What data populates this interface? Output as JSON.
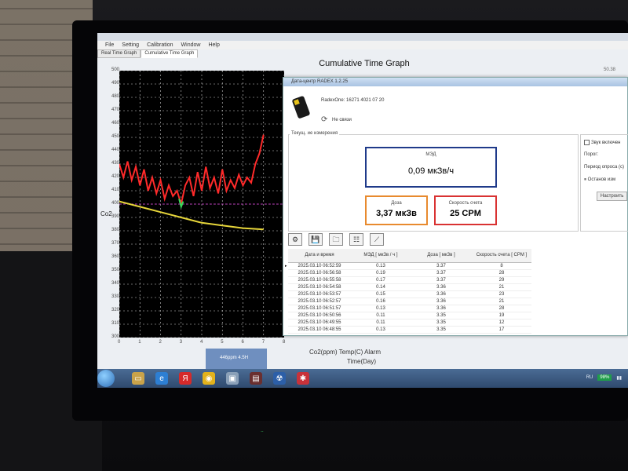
{
  "app": {
    "window_title": "Cumulative Time Graph",
    "menu": [
      "File",
      "Setting",
      "Calibration",
      "Window",
      "Help"
    ],
    "tabs": [
      "Real Time Graph",
      "Cumulative Time Graph"
    ],
    "graph_title": "Cumulative Time Graph",
    "corner_value": "50.38",
    "y_ticks": [
      "500",
      "490",
      "480",
      "470",
      "460",
      "450",
      "440",
      "430",
      "420",
      "410",
      "400",
      "390",
      "380",
      "370",
      "360",
      "350",
      "340",
      "330",
      "320",
      "310",
      "300"
    ],
    "x_ticks": [
      "0",
      "1",
      "2",
      "3",
      "4",
      "5",
      "6",
      "7",
      "8"
    ],
    "y_label": "Co2",
    "legend": "Co2(ppm)  Temp(C)  Alarm",
    "x_label": "Time(Day)",
    "status_box": "446ppm 4.5H"
  },
  "chart_data": {
    "type": "line",
    "xlim": [
      0,
      8
    ],
    "ylim": [
      300,
      500
    ],
    "series": [
      {
        "name": "Co2(ppm)",
        "color": "#ff2a2a",
        "x": [
          0,
          0.2,
          0.4,
          0.6,
          0.8,
          1.0,
          1.2,
          1.4,
          1.6,
          1.8,
          2.0,
          2.2,
          2.4,
          2.6,
          2.8,
          3.0,
          3.2,
          3.4,
          3.6,
          3.8,
          4.0,
          4.2,
          4.4,
          4.6,
          4.8,
          5.0,
          5.2,
          5.4,
          5.6,
          5.8,
          6.0,
          6.2,
          6.4,
          6.6,
          6.8,
          7.0
        ],
        "values": [
          430,
          420,
          432,
          418,
          428,
          414,
          426,
          410,
          420,
          408,
          418,
          404,
          414,
          406,
          410,
          400,
          414,
          420,
          406,
          424,
          410,
          428,
          412,
          420,
          408,
          426,
          410,
          418,
          412,
          422,
          414,
          420,
          416,
          430,
          438,
          452
        ]
      },
      {
        "name": "Temp(C)",
        "color": "#e6d53a",
        "x": [
          0,
          1,
          2,
          3,
          4,
          5,
          6,
          7
        ],
        "values": [
          402,
          398,
          394,
          390,
          386,
          384,
          382,
          381
        ]
      },
      {
        "name": "Alarm",
        "color": "#39d85a",
        "x": [
          2.9,
          3.0,
          3.1
        ],
        "values": [
          404,
          398,
          402
        ]
      }
    ]
  },
  "dialog": {
    "title": "Дата-центр RADEX 1.2.25",
    "device_name": "RadexOne: 16271 4021 07 20",
    "connection": "Не связи",
    "current_group": "Текущ. ие измерения",
    "med_label": "МЭД",
    "med_value": "0,09 мкЗв/ч",
    "dose_label": "Доза",
    "dose_value": "3,37 мкЗв",
    "cpm_label": "Скорость счета",
    "cpm_value": "25 CPM",
    "side": {
      "sound": "Звук включен",
      "threshold": "Порог:",
      "period": "Период опроса (с)",
      "stop": "Останов изм",
      "settings": "Настроить"
    },
    "table_headers": [
      "Дата и время",
      "МЭД [ мкЗв / ч ]",
      "Доза [ мкЗв ]",
      "Скорость счета [ CPM ]"
    ],
    "rows": [
      [
        "2025.03.10 06:52:59",
        "0.13",
        "3.37",
        "8"
      ],
      [
        "2025.03.10 06:56:58",
        "0.19",
        "3.37",
        "28"
      ],
      [
        "2025.03.10 06:55:58",
        "0.17",
        "3.37",
        "29"
      ],
      [
        "2025.03.10 06:54:58",
        "0.14",
        "3.36",
        "21"
      ],
      [
        "2025.03.10 06:53:57",
        "0.15",
        "3.36",
        "23"
      ],
      [
        "2025.03.10 06:52:57",
        "0.16",
        "3.36",
        "21"
      ],
      [
        "2025.03.10 06:51:57",
        "0.13",
        "3.36",
        "28"
      ],
      [
        "2025.03.10 06:50:56",
        "0.11",
        "3.35",
        "19"
      ],
      [
        "2025.03.10 06:49:55",
        "0.11",
        "3.35",
        "12"
      ],
      [
        "2025.03.10 06:48:55",
        "0.13",
        "3.35",
        "17"
      ]
    ]
  },
  "taskbar": {
    "battery": "98%",
    "lang": "RU"
  },
  "colors": {
    "med_border": "#1f3a8a",
    "dose_border": "#e88a2e",
    "cpm_border": "#d93232",
    "plot_bg": "#000000"
  }
}
